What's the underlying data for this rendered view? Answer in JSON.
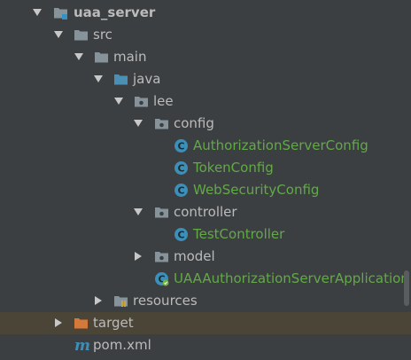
{
  "tree": {
    "root": {
      "label": "uaa_server",
      "icon": "module-folder-icon"
    },
    "src": {
      "label": "src",
      "icon": "folder-icon"
    },
    "main": {
      "label": "main",
      "icon": "folder-icon"
    },
    "java": {
      "label": "java",
      "icon": "source-root-folder-icon"
    },
    "lee": {
      "label": "lee",
      "icon": "package-icon"
    },
    "config": {
      "label": "config",
      "icon": "package-icon"
    },
    "authorization_server_config": {
      "label": "AuthorizationServerConfig",
      "icon": "class-c-icon"
    },
    "token_config": {
      "label": "TokenConfig",
      "icon": "class-c-icon"
    },
    "web_security_config": {
      "label": "WebSecurityConfig",
      "icon": "class-c-icon"
    },
    "controller": {
      "label": "controller",
      "icon": "package-icon"
    },
    "test_controller": {
      "label": "TestController",
      "icon": "class-c-icon"
    },
    "model": {
      "label": "model",
      "icon": "package-icon"
    },
    "application": {
      "label": "UAAAuthorizationServerApplication",
      "icon": "spring-boot-class-icon"
    },
    "resources": {
      "label": "resources",
      "icon": "resources-folder-icon"
    },
    "target": {
      "label": "target",
      "icon": "excluded-folder-icon"
    },
    "pom": {
      "label": "pom.xml",
      "icon": "maven-m-icon"
    }
  },
  "colors": {
    "background": "#3c3f41",
    "text": "#bbbbbb",
    "class_text": "#62a947",
    "highlight_row": "#4b4538",
    "folder": "#87939a",
    "source_folder": "#4c8fb5",
    "excluded_folder": "#d4793a",
    "class_icon": "#3d8fb8"
  }
}
